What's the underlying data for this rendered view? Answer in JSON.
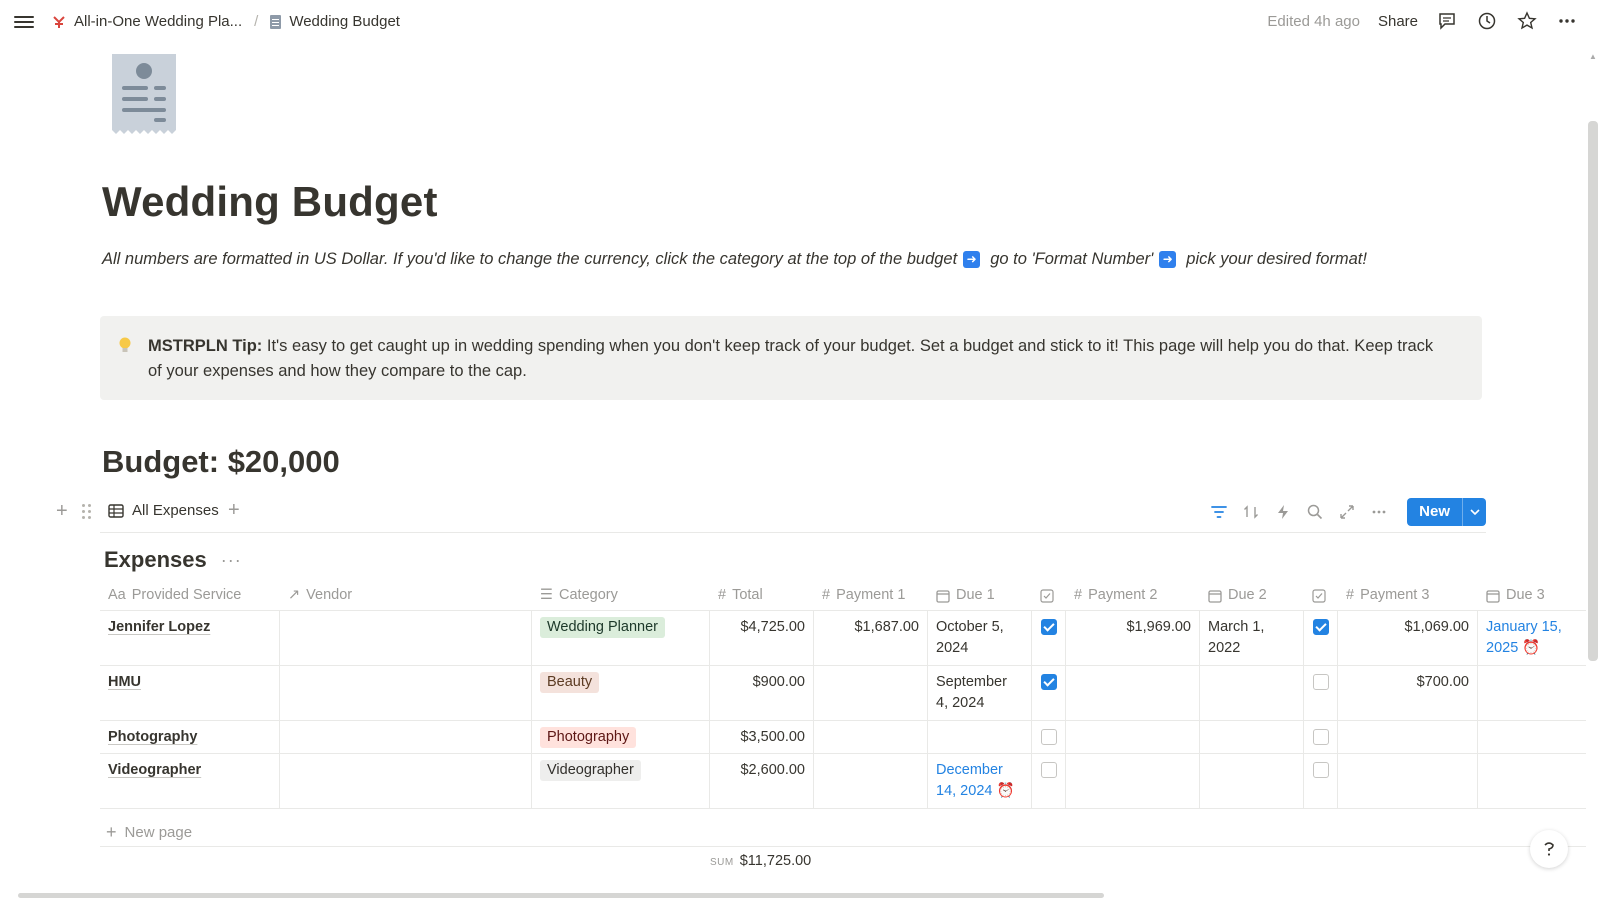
{
  "topbar": {
    "breadcrumb_parent": "All-in-One Wedding Pla...",
    "breadcrumb_sep": "/",
    "breadcrumb_current": "Wedding Budget",
    "edited": "Edited 4h ago",
    "share": "Share"
  },
  "page": {
    "title": "Wedding Budget",
    "intro_1": "All numbers are formatted in US Dollar. If you'd like to change the currency, click the category at the top of the budget",
    "intro_2": "go to 'Format Number'",
    "intro_3": "pick your desired format!",
    "callout_bold": "MSTRPLN Tip:",
    "callout_text": " It's easy to get caught up in wedding spending when you don't keep track of your budget. Set a budget and stick to it! This page will help you do that. Keep track of your expenses and how they compare to the cap.",
    "budget_heading": "Budget: $20,000"
  },
  "view": {
    "tab_label": "All Expenses",
    "new_label": "New"
  },
  "database": {
    "title": "Expenses",
    "columns": [
      "Provided Service",
      "Vendor",
      "Category",
      "Total",
      "Payment 1",
      "Due 1",
      "",
      "Payment 2",
      "Due 2",
      "",
      "Payment 3",
      "Due 3"
    ],
    "column_icons": [
      "Aa",
      "↗",
      "☰",
      "#",
      "#",
      "cal",
      "chk",
      "#",
      "cal",
      "chk",
      "#",
      "cal"
    ],
    "rows": [
      {
        "service": "Jennifer Lopez",
        "vendor": "",
        "category": "Wedding Planner",
        "total": "$4,725.00",
        "payment1": "$1,687.00",
        "due1": "October 5, 2024",
        "paid1": true,
        "payment2": "$1,969.00",
        "due2": "March 1, 2022",
        "paid2": true,
        "payment3": "$1,069.00",
        "due3": "January 15, 2025"
      },
      {
        "service": "HMU",
        "vendor": "",
        "category": "Beauty",
        "total": "$900.00",
        "payment1": "",
        "due1": "September 4, 2024",
        "paid1": true,
        "payment2": "",
        "due2": "",
        "paid2": false,
        "payment3": "$700.00",
        "due3": ""
      },
      {
        "service": "Photography",
        "vendor": "",
        "category": "Photography",
        "total": "$3,500.00",
        "payment1": "",
        "due1": "",
        "paid1": false,
        "payment2": "",
        "due2": "",
        "paid2": false,
        "payment3": "",
        "due3": ""
      },
      {
        "service": "Videographer",
        "vendor": "",
        "category": "Videographer",
        "total": "$2,600.00",
        "payment1": "",
        "due1": "December 14, 2024",
        "paid1": false,
        "payment2": "",
        "due2": "",
        "paid2": false,
        "payment3": "",
        "due3": ""
      }
    ],
    "new_page": "New page",
    "sum_label": "SUM",
    "sum_value": "$11,725.00"
  },
  "colors": {
    "accent": "#2383e2",
    "callout_bg": "#f1f1ef",
    "text": "#37352f"
  }
}
